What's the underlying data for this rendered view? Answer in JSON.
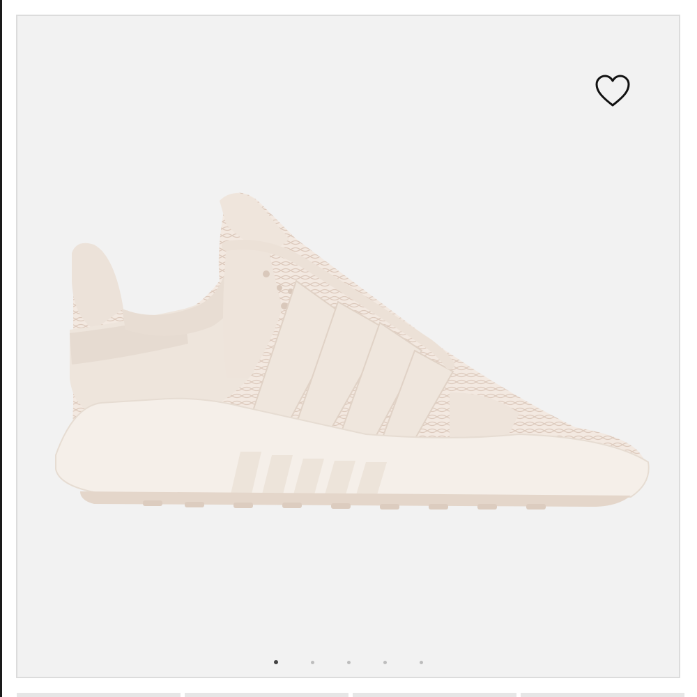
{
  "product": {
    "image_alt": "Cream sneaker",
    "colors": {
      "card_bg": "#f2f2f2",
      "shoe": "#efe6de",
      "shoe_shadow": "#e0d3c8",
      "sole": "#f4efe9"
    }
  },
  "favorite": {
    "icon": "heart-outline-icon",
    "label": ""
  },
  "carousel": {
    "count": 5,
    "active_index": 0
  },
  "colors": {
    "dot_active": "#444444",
    "dot_inactive": "#bdbdbd",
    "border": "#dcdcdc"
  }
}
